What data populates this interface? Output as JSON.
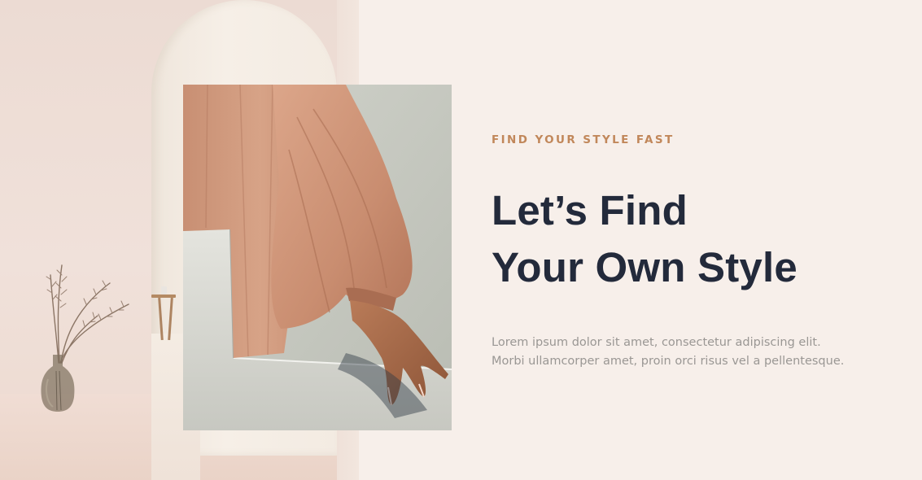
{
  "hero": {
    "eyebrow": "FIND YOUR STYLE FAST",
    "headline_lines": [
      "Let’s Find",
      "Your Own Style"
    ],
    "body_lines": [
      "Lorem ipsum dolor sit amet, consectetur adipiscing elit.",
      "Morbi ullamcorper amet, proin orci risus vel a pellentesque."
    ]
  },
  "colors": {
    "page_background": "#f7efea",
    "accent": "#c1875a",
    "heading": "#232a3b",
    "body_text": "#9a9794"
  },
  "images": {
    "scene": "room-arch-vase-photo",
    "feature": "sleeve-hand-fabric-photo"
  }
}
